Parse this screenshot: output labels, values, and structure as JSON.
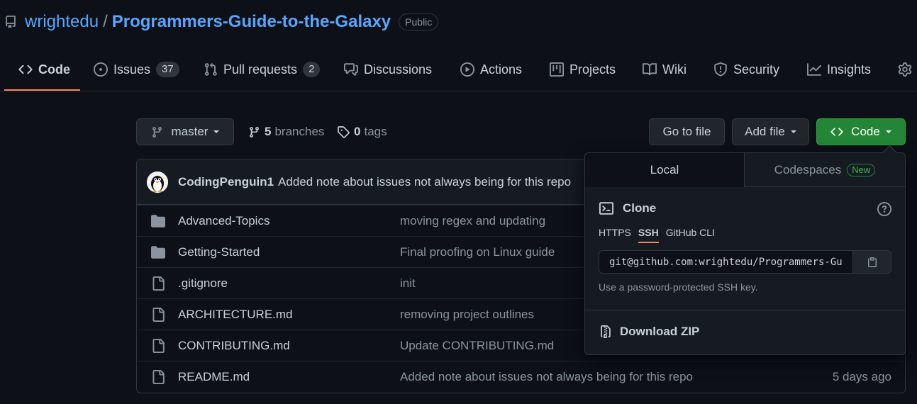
{
  "repo": {
    "owner": "wrightedu",
    "separator": "/",
    "name": "Programmers-Guide-to-the-Galaxy",
    "visibility": "Public"
  },
  "tabs": [
    {
      "label": "Code",
      "icon": "code-icon",
      "active": true
    },
    {
      "label": "Issues",
      "icon": "issue-icon",
      "count": "37"
    },
    {
      "label": "Pull requests",
      "icon": "pull-request-icon",
      "count": "2"
    },
    {
      "label": "Discussions",
      "icon": "discussions-icon"
    },
    {
      "label": "Actions",
      "icon": "play-icon"
    },
    {
      "label": "Projects",
      "icon": "project-icon"
    },
    {
      "label": "Wiki",
      "icon": "book-icon"
    },
    {
      "label": "Security",
      "icon": "shield-icon"
    },
    {
      "label": "Insights",
      "icon": "graph-icon"
    },
    {
      "label": "",
      "icon": "gear-icon"
    }
  ],
  "toolbar": {
    "branch": "master",
    "branches_count": "5",
    "branches_label": "branches",
    "tags_count": "0",
    "tags_label": "tags",
    "go_to_file": "Go to file",
    "add_file": "Add file",
    "code": "Code"
  },
  "latest_commit": {
    "author": "CodingPenguin1",
    "message": "Added note about issues not always being for this repo"
  },
  "files": [
    {
      "name": "Advanced-Topics",
      "type": "folder",
      "message": "moving regex and updating",
      "date": ""
    },
    {
      "name": "Getting-Started",
      "type": "folder",
      "message": "Final proofing on Linux guide",
      "date": ""
    },
    {
      "name": ".gitignore",
      "type": "file",
      "message": "init",
      "date": ""
    },
    {
      "name": "ARCHITECTURE.md",
      "type": "file",
      "message": "removing project outlines",
      "date": ""
    },
    {
      "name": "CONTRIBUTING.md",
      "type": "file",
      "message": "Update CONTRIBUTING.md",
      "date": ""
    },
    {
      "name": "README.md",
      "type": "file",
      "message": "Added note about issues not always being for this repo",
      "date": "5 days ago"
    }
  ],
  "clone_menu": {
    "tab_local": "Local",
    "tab_codespaces": "Codespaces",
    "new_badge": "New",
    "clone_title": "Clone",
    "protocols": [
      "HTTPS",
      "SSH",
      "GitHub CLI"
    ],
    "active_protocol": "SSH",
    "url": "git@github.com:wrightedu/Programmers-Guide-to-the-Galaxy.git",
    "hint": "Use a password-protected SSH key.",
    "download_zip": "Download ZIP"
  },
  "colors": {
    "background": "#0d1117",
    "link": "#58a6ff",
    "accent_underline": "#f78166",
    "green_button": "#238636"
  }
}
